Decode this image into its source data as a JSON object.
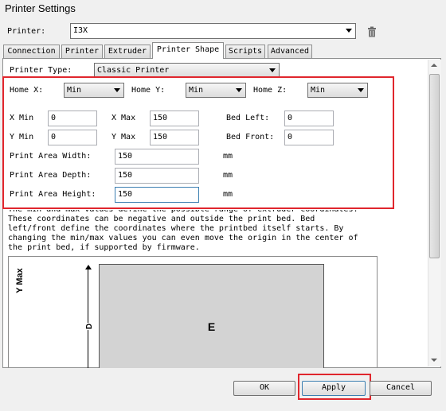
{
  "window": {
    "title": "Printer Settings"
  },
  "printer": {
    "label": "Printer:",
    "value": "I3X"
  },
  "tabs": [
    {
      "label": "Connection"
    },
    {
      "label": "Printer"
    },
    {
      "label": "Extruder"
    },
    {
      "label": "Printer Shape"
    },
    {
      "label": "Scripts"
    },
    {
      "label": "Advanced"
    }
  ],
  "printer_type": {
    "label": "Printer Type:",
    "value": "Classic Printer"
  },
  "home": {
    "x_label": "Home X:",
    "x_value": "Min",
    "y_label": "Home Y:",
    "y_value": "Min",
    "z_label": "Home Z:",
    "z_value": "Min"
  },
  "coords": {
    "x_min_label": "X Min",
    "x_min": "0",
    "x_max_label": "X Max",
    "x_max": "150",
    "bed_left_label": "Bed Left:",
    "bed_left": "0",
    "y_min_label": "Y Min",
    "y_min": "0",
    "y_max_label": "Y Max",
    "y_max": "150",
    "bed_front_label": "Bed Front:",
    "bed_front": "0"
  },
  "area": {
    "width_label": "Print Area Width:",
    "width": "150",
    "width_unit": "mm",
    "depth_label": "Print Area Depth:",
    "depth": "150",
    "depth_unit": "mm",
    "height_label": "Print Area Height:",
    "height": "150",
    "height_unit": "mm"
  },
  "description": {
    "line1": "The min and max values define the possible range of extruder coordinates.",
    "line2": "These coordinates can be negative and outside the print bed. Bed",
    "line3": "left/front define the coordinates where the printbed itself starts. By",
    "line4": "changing the min/max values you can even move the origin in the center of",
    "line5": "the print bed, if supported by firmware."
  },
  "diagram": {
    "y_axis_label": "Y Max",
    "depth_letter": "D",
    "area_letter": "E"
  },
  "buttons": {
    "ok": "OK",
    "apply": "Apply",
    "cancel": "Cancel"
  },
  "colors": {
    "highlight": "#e0262d",
    "bed_fill": "#d3d3d3"
  },
  "icons": {
    "delete": "trash-icon",
    "dropdown": "chevron-down-icon"
  }
}
